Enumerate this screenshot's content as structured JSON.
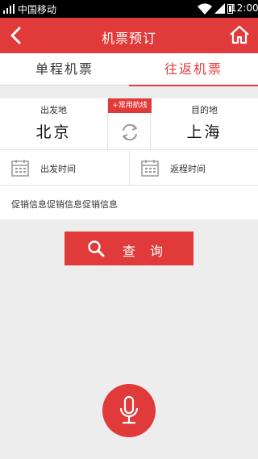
{
  "statusbar": {
    "carrier": "中国移动",
    "time": "12:00"
  },
  "header": {
    "title": "机票预订",
    "back_icon": "chevron-left-icon",
    "home_icon": "home-icon"
  },
  "tabs": [
    {
      "label": "单程机票",
      "active": false
    },
    {
      "label": "往返机票",
      "active": true
    }
  ],
  "route": {
    "departure_label": "出发地",
    "departure_city": "北京",
    "arrival_label": "目的地",
    "arrival_city": "上海",
    "common_routes_label": "+常用航线",
    "swap_icon": "swap-icon"
  },
  "dates": {
    "departure_label": "出发时间",
    "return_label": "返程时间",
    "icon": "calendar-icon"
  },
  "promo": {
    "text": "促销信息促销信息促销信息"
  },
  "search_button": {
    "label": "查询",
    "icon": "search-icon"
  },
  "voice_button": {
    "icon": "microphone-icon"
  },
  "colors": {
    "accent": "#e13a3a",
    "background": "#ededed"
  }
}
